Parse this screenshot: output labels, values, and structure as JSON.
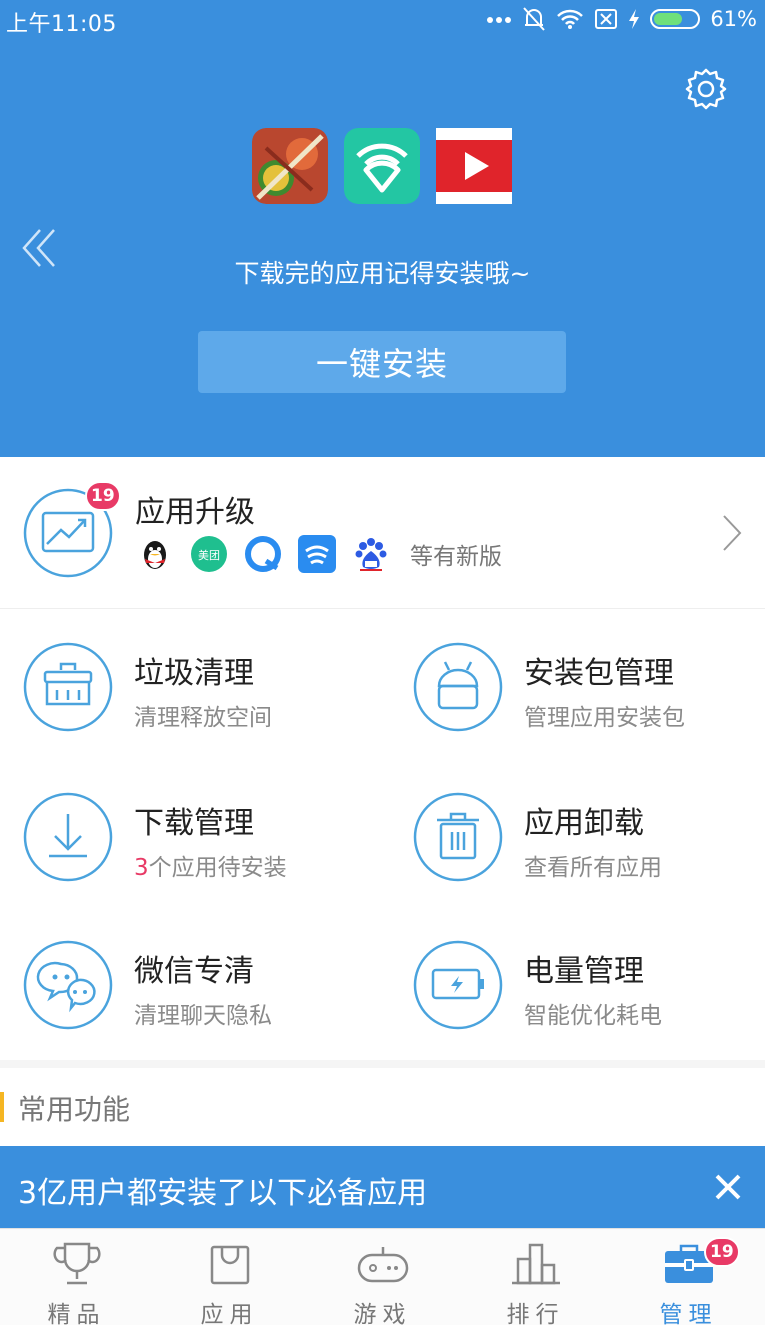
{
  "status_bar": {
    "time": "上午11:05",
    "battery": "61%"
  },
  "header": {
    "hint": "下载完的应用记得安装哦~",
    "install_button": "一键安装",
    "pending_apps": [
      "fruit-ninja-icon",
      "wifi-shield-icon",
      "video-play-icon"
    ]
  },
  "upgrade": {
    "title": "应用升级",
    "badge": "19",
    "apps": [
      "qq-penguin-icon",
      "meituan-icon",
      "browser-icon",
      "weather-icon",
      "baidu-icon"
    ],
    "meituan_label": "美团",
    "more": "等有新版"
  },
  "tools": [
    {
      "title": "垃圾清理",
      "subtitle": "清理释放空间"
    },
    {
      "title": "安装包管理",
      "subtitle": "管理应用安装包"
    },
    {
      "title": "下载管理",
      "subtitle_num": "3",
      "subtitle": "个应用待安装"
    },
    {
      "title": "应用卸载",
      "subtitle": "查看所有应用"
    },
    {
      "title": "微信专清",
      "subtitle": "清理聊天隐私"
    },
    {
      "title": "电量管理",
      "subtitle": "智能优化耗电"
    }
  ],
  "common": {
    "label": "常用功能"
  },
  "banner": {
    "text": "3亿用户都安装了以下必备应用"
  },
  "nav": {
    "items": [
      {
        "label": "精品"
      },
      {
        "label": "应用"
      },
      {
        "label": "游戏"
      },
      {
        "label": "排行"
      },
      {
        "label": "管理"
      }
    ],
    "active": "管理",
    "badge": "19"
  },
  "colors": {
    "primary": "#3a8fdd",
    "badge": "#e83a66",
    "accent_bar": "#f5b623",
    "icon_line": "#4aa3dd"
  }
}
